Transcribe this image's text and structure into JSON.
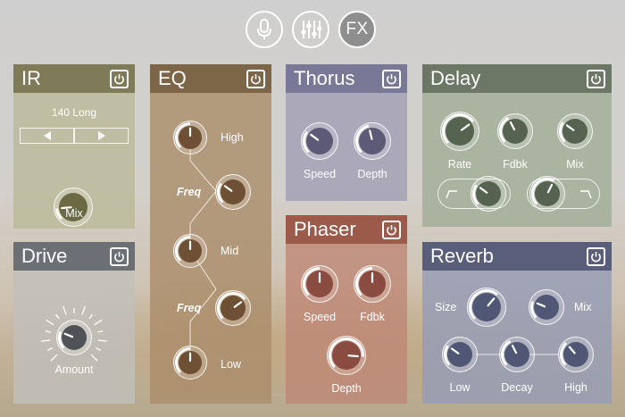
{
  "colors": {
    "ir_header": "#7f7a58",
    "ir_body": "rgba(186,184,150,0.78)",
    "drive_header": "#6c7075",
    "drive_body": "rgba(192,192,188,0.78)",
    "eq_header": "#7d6548",
    "eq_body": "rgba(170,140,105,0.80)",
    "thorus_header": "#7a7897",
    "thorus_body": "rgba(160,158,180,0.80)",
    "phaser_header": "#9c5a4b",
    "phaser_body": "rgba(190,135,118,0.80)",
    "delay_header": "#6c7766",
    "delay_body": "rgba(160,172,150,0.80)",
    "reverb_header": "#595e7a",
    "reverb_body": "rgba(150,156,182,0.82)",
    "knob_ir": "#6b6a45",
    "knob_eq": "#6e5035",
    "knob_thorus": "#5d5a78",
    "knob_phaser": "#8a4b40",
    "knob_delay": "#566350",
    "knob_reverb": "#4f5775",
    "knob_drive": "#4f5257"
  },
  "toolbar": {
    "mic_icon": "microphone-icon",
    "mixer_icon": "mixer-sliders-icon",
    "fx_label": "FX"
  },
  "ir": {
    "title": "IR",
    "preset": "140 Long",
    "prev_icon": "triangle-left-icon",
    "next_icon": "triangle-right-icon",
    "mix_label": "Mix",
    "mix_value": 0.15
  },
  "drive": {
    "title": "Drive",
    "amount_label": "Amount",
    "amount_value": 0.25
  },
  "eq": {
    "title": "EQ",
    "high_label": "High",
    "high_value": 0.5,
    "freq_label_1": "Freq",
    "freq1_value": 0.3,
    "mid_label": "Mid",
    "mid_value": 0.5,
    "freq_label_2": "Freq",
    "freq2_value": 0.7,
    "low_label": "Low",
    "low_value": 0.5
  },
  "thorus": {
    "title": "Thorus",
    "speed_label": "Speed",
    "speed_value": 0.3,
    "depth_label": "Depth",
    "depth_value": 0.45
  },
  "phaser": {
    "title": "Phaser",
    "speed_label": "Speed",
    "speed_value": 0.5,
    "fdbk_label": "Fdbk",
    "fdbk_value": 0.5,
    "depth_label": "Depth",
    "depth_value": 0.85
  },
  "delay": {
    "title": "Delay",
    "rate_label": "Rate",
    "rate_value": 0.7,
    "fdbk_label": "Fdbk",
    "fdbk_value": 0.4,
    "mix_label": "Mix",
    "mix_value": 0.3,
    "lowcut_value": 0.3,
    "highcut_value": 0.6,
    "lowcut_icon": "low-cut-icon",
    "highcut_icon": "high-cut-icon"
  },
  "reverb": {
    "title": "Reverb",
    "size_label": "Size",
    "size_value": 0.65,
    "mix_label": "Mix",
    "mix_value": 0.25,
    "low_label": "Low",
    "low_value": 0.3,
    "decay_label": "Decay",
    "decay_value": 0.4,
    "high_label": "High",
    "high_value": 0.35
  }
}
